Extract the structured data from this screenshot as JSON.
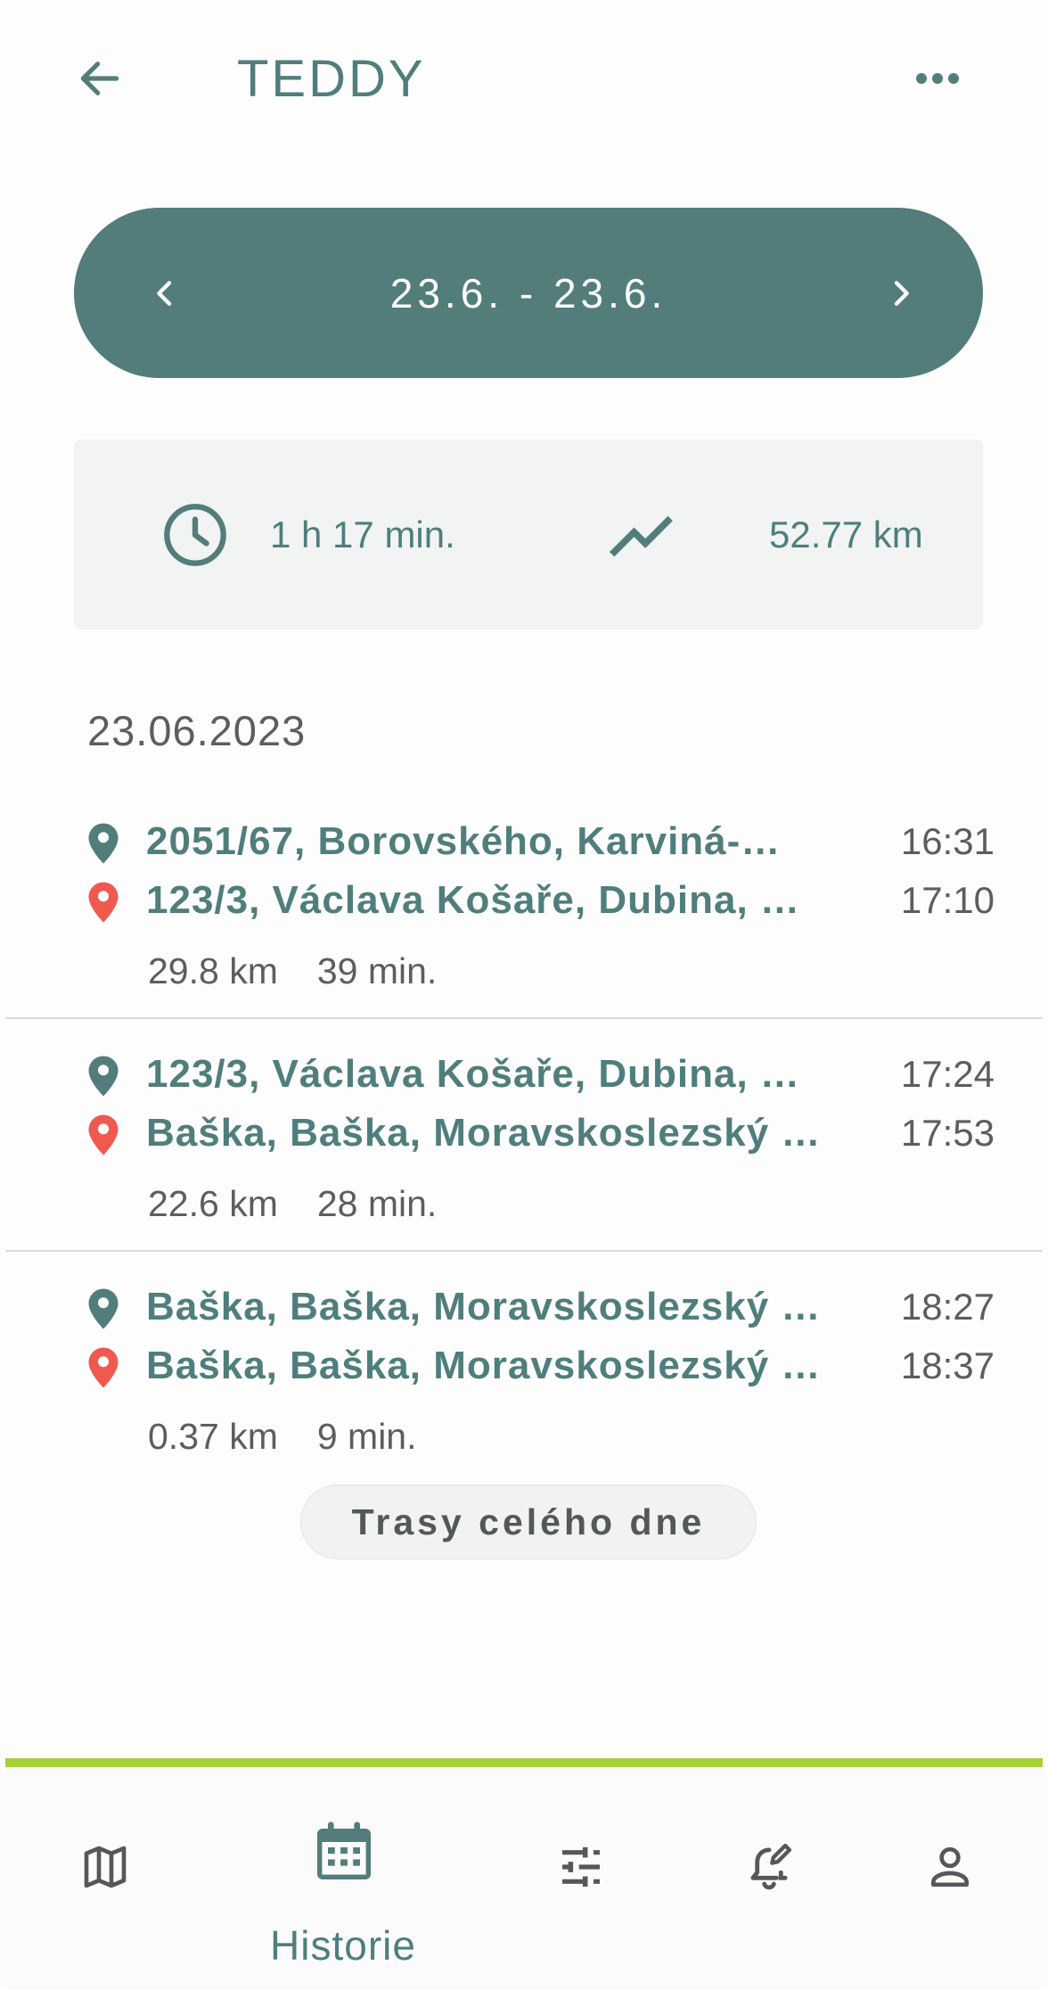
{
  "header": {
    "title": "TEDDY"
  },
  "date_range": {
    "label": "23.6. - 23.6."
  },
  "summary": {
    "duration": "1 h 17 min.",
    "distance": "52.77 km"
  },
  "day": {
    "date": "23.06.2023"
  },
  "trips": [
    {
      "start_address": "2051/67, Borovského, Karviná-…",
      "start_time": "16:31",
      "end_address": "123/3, Václava Košaře, Dubina, …",
      "end_time": "17:10",
      "distance": "29.8 km",
      "duration": "39 min."
    },
    {
      "start_address": "123/3, Václava Košaře, Dubina, …",
      "start_time": "17:24",
      "end_address": "Baška, Baška, Moravskoslezský …",
      "end_time": "17:53",
      "distance": "22.6 km",
      "duration": "28 min."
    },
    {
      "start_address": "Baška, Baška, Moravskoslezský …",
      "start_time": "18:27",
      "end_address": "Baška, Baška, Moravskoslezský …",
      "end_time": "18:37",
      "distance": "0.37 km",
      "duration": "9 min."
    }
  ],
  "all_day_button": {
    "label": "Trasy celého dne"
  },
  "bottom_nav": {
    "items": [
      {
        "icon": "map-icon",
        "label": ""
      },
      {
        "icon": "calendar-icon",
        "label": "Historie",
        "active": true
      },
      {
        "icon": "sliders-icon",
        "label": ""
      },
      {
        "icon": "bell-edit-icon",
        "label": ""
      },
      {
        "icon": "person-icon",
        "label": ""
      }
    ]
  },
  "colors": {
    "primary": "#527d7b",
    "accent": "#a9d138",
    "end_pin": "#ef5a50",
    "text_gray": "#5b5e60"
  }
}
